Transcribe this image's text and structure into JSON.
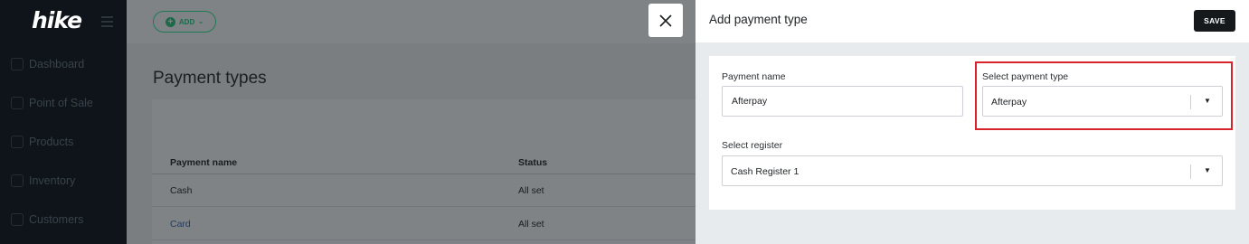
{
  "sidebar": {
    "logo": "hike",
    "items": [
      {
        "label": "Dashboard",
        "icon": "home-icon"
      },
      {
        "label": "Point of Sale",
        "icon": "shop-icon"
      },
      {
        "label": "Products",
        "icon": "tag-icon"
      },
      {
        "label": "Inventory",
        "icon": "box-icon"
      },
      {
        "label": "Customers",
        "icon": "user-icon"
      }
    ]
  },
  "toolbar": {
    "add_label": "ADD"
  },
  "main": {
    "title": "Payment types",
    "table": {
      "headers": [
        "Payment name",
        "Status"
      ],
      "rows": [
        {
          "name": "Cash",
          "status": "All set"
        },
        {
          "name": "Card",
          "status": "All set"
        }
      ]
    }
  },
  "panel": {
    "title": "Add payment type",
    "save_label": "SAVE",
    "payment_name_label": "Payment name",
    "payment_name_value": "Afterpay",
    "payment_type_label": "Select payment type",
    "payment_type_value": "Afterpay",
    "register_label": "Select register",
    "register_value": "Cash Register 1"
  },
  "colors": {
    "highlight": "#d9232b",
    "accent": "#1b6b4a",
    "sidebar": "#0e1419"
  }
}
